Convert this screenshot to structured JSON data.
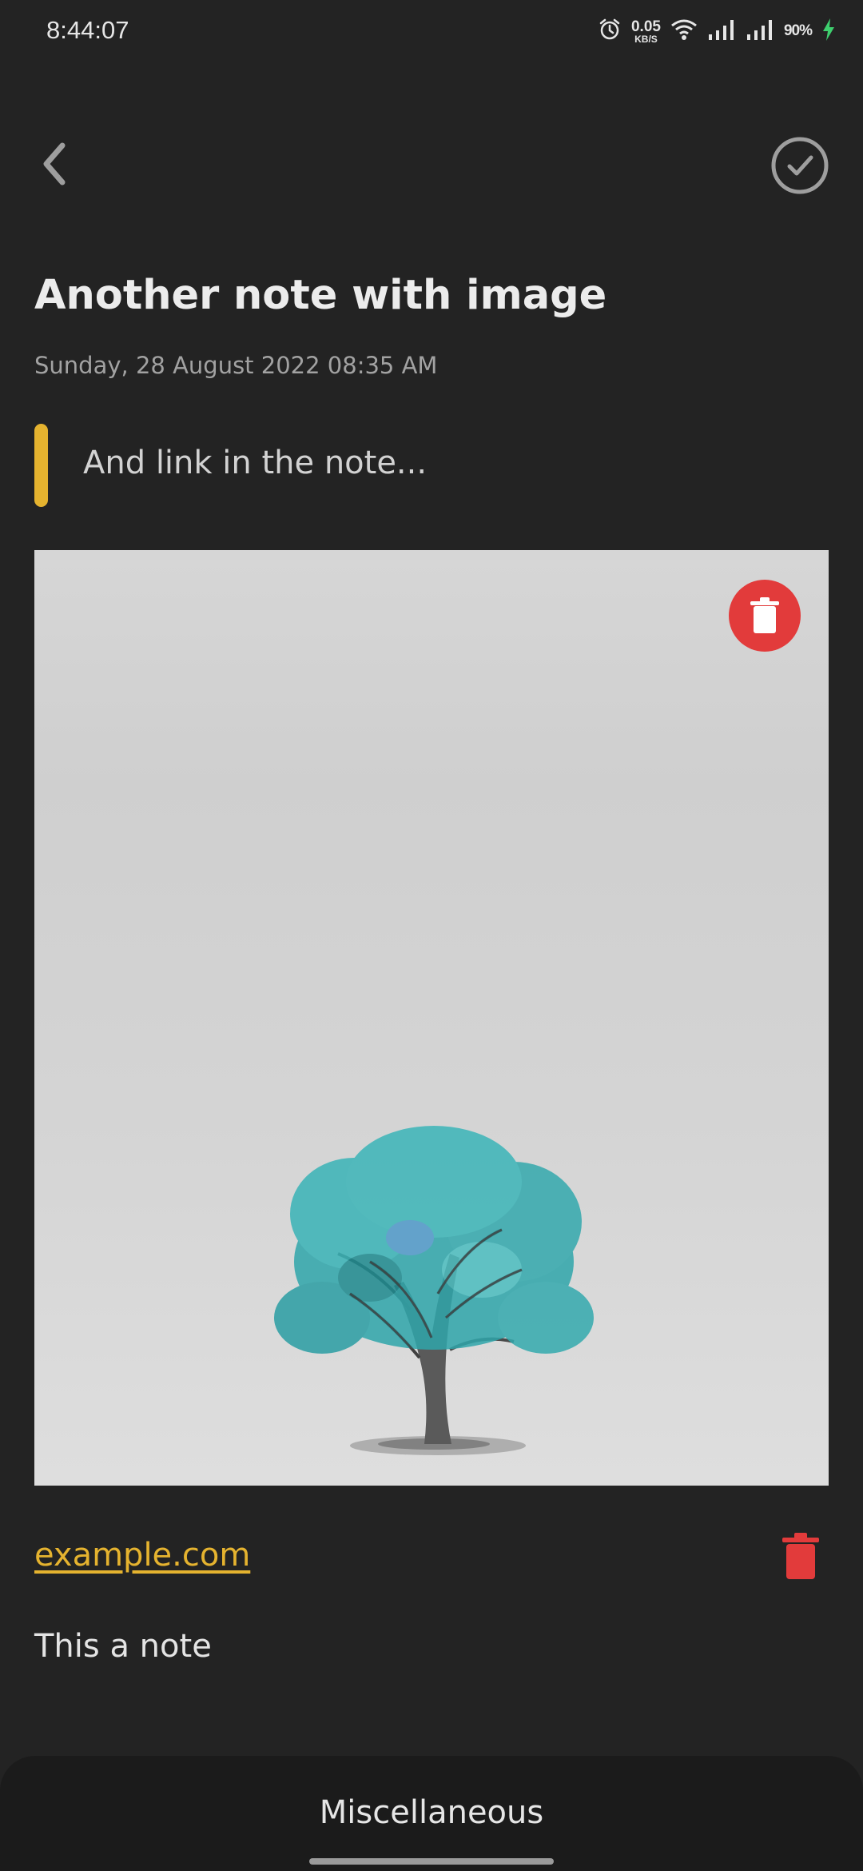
{
  "status_bar": {
    "time": "8:44:07",
    "net_speed_value": "0.05",
    "net_speed_unit": "KB/S",
    "battery": "90%",
    "icons": [
      "alarm-icon",
      "wifi-icon",
      "signal-icon",
      "signal-icon",
      "charging-icon"
    ]
  },
  "toolbar": {
    "back_icon": "chevron-left-icon",
    "done_icon": "check-circle-icon"
  },
  "note": {
    "title": "Another note with image",
    "date": "Sunday, 28 August 2022 08:35 AM",
    "subtitle": "And link in the note...",
    "image_description_icon": "tree-watercolor-image",
    "link": "example.com",
    "text": "This a note"
  },
  "bottom_sheet": {
    "label": "Miscellaneous"
  },
  "colors": {
    "background": "#232323",
    "accent": "#e5b32f",
    "danger": "#e23b3b",
    "sheet": "#1b1b1b"
  }
}
